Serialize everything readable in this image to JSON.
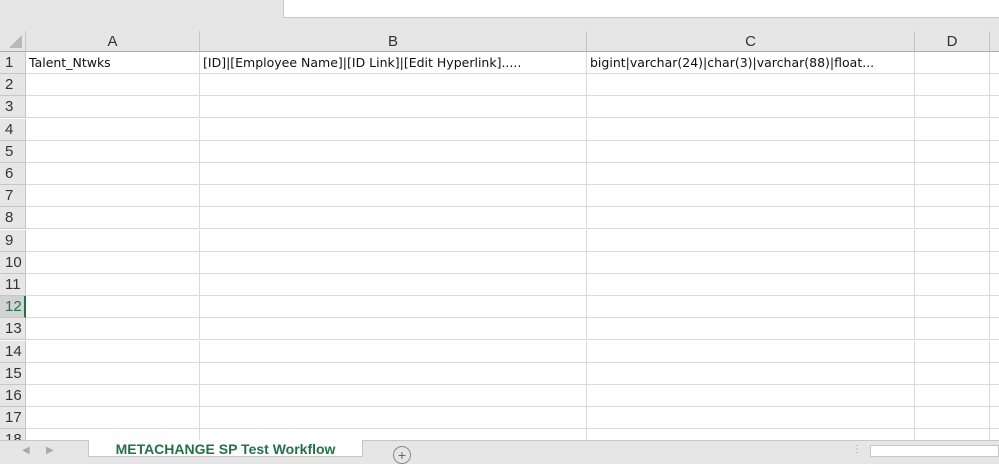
{
  "columns": [
    "A",
    "B",
    "C",
    "D"
  ],
  "rows": [
    {
      "num": "1",
      "cells": [
        "Talent_Ntwks",
        "[ID]|[Employee Name]|[ID Link]|[Edit Hyperlink].....",
        "bigint|varchar(24)|char(3)|varchar(88)|float...",
        ""
      ]
    },
    {
      "num": "2"
    },
    {
      "num": "3"
    },
    {
      "num": "4"
    },
    {
      "num": "5"
    },
    {
      "num": "6"
    },
    {
      "num": "7"
    },
    {
      "num": "8"
    },
    {
      "num": "9"
    },
    {
      "num": "10"
    },
    {
      "num": "11"
    },
    {
      "num": "12",
      "selected": true
    },
    {
      "num": "13"
    },
    {
      "num": "14"
    },
    {
      "num": "15"
    },
    {
      "num": "16"
    },
    {
      "num": "17"
    },
    {
      "num": "18"
    }
  ],
  "sheet_tab": "METACHANGE SP Test Workflow",
  "add_sheet_icon": "plus-circle-icon",
  "accent": "#217346"
}
